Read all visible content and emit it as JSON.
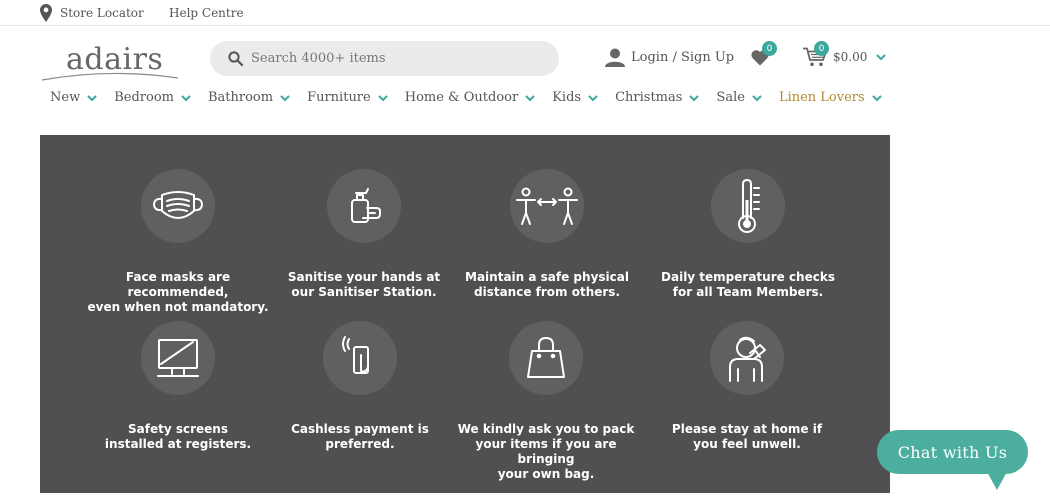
{
  "topbar": {
    "store_locator": "Store Locator",
    "help_centre": "Help Centre"
  },
  "brand": {
    "logo_text": "adairs"
  },
  "search": {
    "placeholder": "Search 4000+ items"
  },
  "account": {
    "login_label": "Login / Sign Up"
  },
  "wishlist": {
    "count": "0"
  },
  "cart": {
    "count": "0",
    "total": "$0.00"
  },
  "nav": {
    "items": [
      {
        "label": "New"
      },
      {
        "label": "Bedroom"
      },
      {
        "label": "Bathroom"
      },
      {
        "label": "Furniture"
      },
      {
        "label": "Home & Outdoor"
      },
      {
        "label": "Kids"
      },
      {
        "label": "Christmas"
      },
      {
        "label": "Sale"
      },
      {
        "label": "Linen Lovers"
      }
    ]
  },
  "safety": {
    "items": [
      {
        "caption": "Face masks are recommended,\neven when not mandatory.",
        "icon": "face-mask-icon"
      },
      {
        "caption": "Sanitise your hands at\nour Sanitiser Station.",
        "icon": "hand-sanitiser-icon"
      },
      {
        "caption": "Maintain a safe physical\ndistance from others.",
        "icon": "social-distance-icon"
      },
      {
        "caption": "Daily temperature checks\nfor all Team Members.",
        "icon": "thermometer-icon"
      },
      {
        "caption": "Safety screens\ninstalled at registers.",
        "icon": "safety-screen-icon"
      },
      {
        "caption": "Cashless payment is\npreferred.",
        "icon": "contactless-payment-icon"
      },
      {
        "caption": "We kindly ask you to pack\nyour items if you are bringing\nyour own bag.",
        "icon": "shopping-bag-icon"
      },
      {
        "caption": "Please stay at home if\nyou feel unwell.",
        "icon": "unwell-person-icon"
      }
    ]
  },
  "chat": {
    "label": "Chat with Us"
  },
  "colors": {
    "accent": "#3aa89a",
    "banner": "#505052",
    "highlight": "#b08a2f"
  }
}
